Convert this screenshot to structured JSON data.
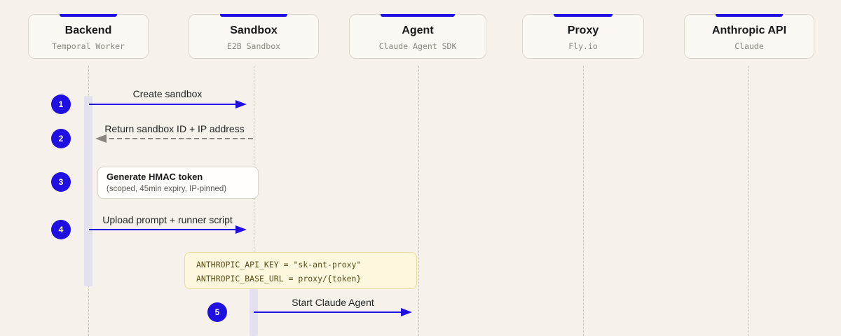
{
  "participants": [
    {
      "name": "Backend",
      "sub": "Temporal Worker"
    },
    {
      "name": "Sandbox",
      "sub": "E2B Sandbox"
    },
    {
      "name": "Agent",
      "sub": "Claude Agent SDK"
    },
    {
      "name": "Proxy",
      "sub": "Fly.io"
    },
    {
      "name": "Anthropic API",
      "sub": "Claude"
    }
  ],
  "steps": [
    {
      "number": "1",
      "label": "Create sandbox"
    },
    {
      "number": "2",
      "label": "Return sandbox ID + IP address"
    },
    {
      "number": "3",
      "note_title": "Generate HMAC token",
      "note_detail": "(scoped, 45min expiry, IP-pinned)"
    },
    {
      "number": "4",
      "label": "Upload prompt + runner script"
    },
    {
      "number": "5",
      "label": "Start Claude Agent"
    }
  ],
  "env_note": {
    "line1": "ANTHROPIC_API_KEY = \"sk-ant-proxy\"",
    "line2": "ANTHROPIC_BASE_URL = proxy/{token}"
  },
  "colors": {
    "accent": "#1f0fe0",
    "return_arrow": "#8a857e",
    "background": "#f6f1ea",
    "env_note_bg": "#fdf8dd"
  }
}
